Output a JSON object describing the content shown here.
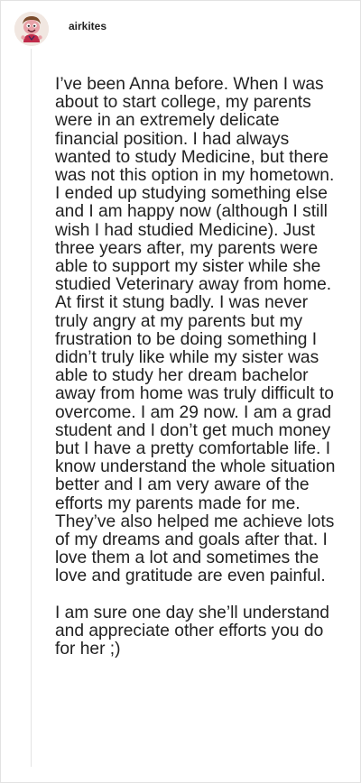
{
  "post": {
    "username": "airkites",
    "avatar_icon": "cartoon-character-avatar",
    "paragraphs": [
      "I’ve been Anna before. When I was about to start college, my parents were in an extremely delicate financial position. I had always wanted to study Medicine, but there was not this option in my hometown. I ended up studying something else and I am happy now (although I still wish I had studied Medicine). Just three years after, my parents were able to support my sister while she studied Veterinary away from home. At first it stung badly. I was never truly angry at my parents but my frustration to be doing something I didn’t truly like while my sister was able to study her dream bachelor away from home was truly difficult to overcome. I am 29 now. I am a grad student and I don’t get much money but I have a pretty comfortable life. I know understand the whole situation better and I am very aware of the efforts my parents made for me. They’ve also helped me achieve lots of my dreams and goals after that. I love them a lot and sometimes the love and gratitude are even painful.",
      "I am sure one day she’ll understand and appreciate other efforts you do for her ;)"
    ]
  }
}
